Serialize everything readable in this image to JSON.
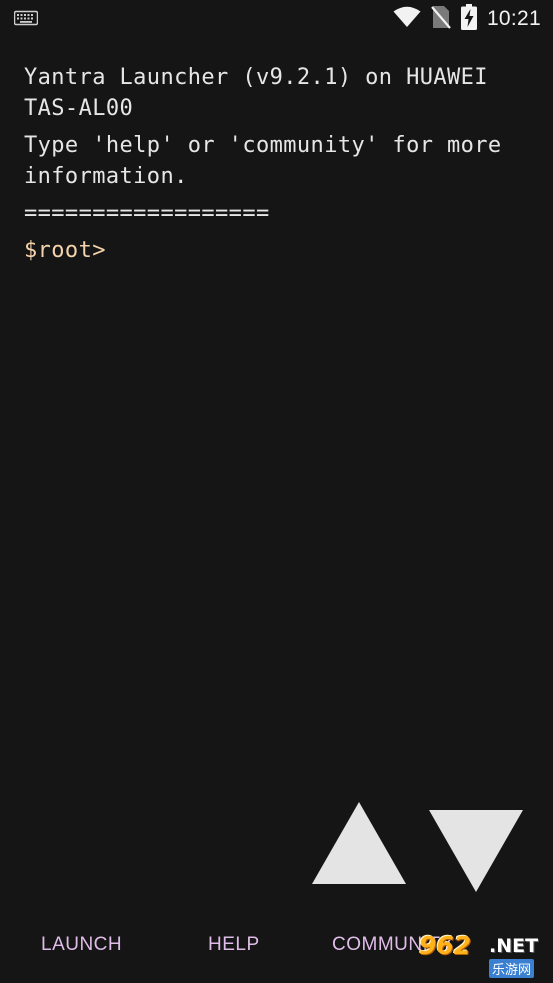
{
  "status_bar": {
    "time": "10:21",
    "icons": [
      "keyboard-icon",
      "wifi-icon",
      "no-sim-icon",
      "battery-charging-icon"
    ]
  },
  "terminal": {
    "line1": "Yantra Launcher (v9.2.1) on HUAWEI TAS-AL00",
    "line2": "Type 'help' or 'community' for more information.",
    "separator": "==================",
    "prompt": "$root>"
  },
  "controls": {
    "up": "arrow-up-icon",
    "down": "arrow-down-icon"
  },
  "suggestions": {
    "items": [
      {
        "label": "LAUNCH"
      },
      {
        "label": "HELP"
      },
      {
        "label": "COMMUNITY"
      }
    ]
  },
  "colors": {
    "background": "#151515",
    "text": "#e6e6e6",
    "prompt": "#f3d2ac",
    "suggestion": "#e0bde8",
    "arrows": "#e4e4e4"
  },
  "watermark": {
    "number": "962",
    "net": ".NET",
    "sub": "乐游网"
  }
}
